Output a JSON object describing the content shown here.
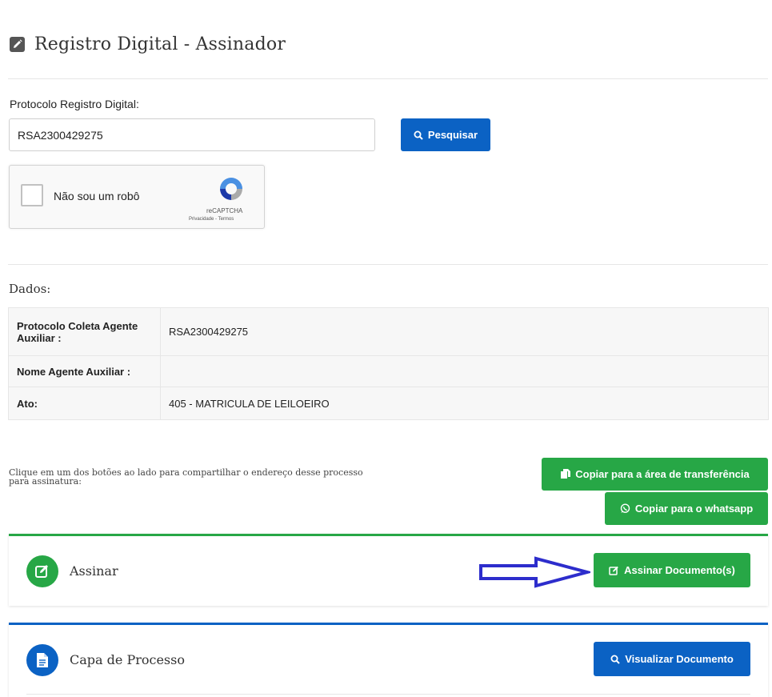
{
  "page": {
    "title": "Registro Digital - Assinador",
    "title_icon": "pencil-square-icon"
  },
  "search": {
    "label": "Protocolo Registro Digital:",
    "value": "RSA2300429275",
    "button_label": "Pesquisar",
    "button_icon": "search-icon"
  },
  "captcha": {
    "label": "Não sou um robô",
    "brand": "reCAPTCHA",
    "terms": "Privacidade - Termos"
  },
  "dados": {
    "title": "Dados:",
    "rows": [
      {
        "key": "Protocolo Coleta Agente Auxiliar :",
        "value": "RSA2300429275"
      },
      {
        "key": "Nome Agente Auxiliar :",
        "value": ""
      },
      {
        "key": "Ato:",
        "value": "405 - MATRICULA DE LEILOEIRO"
      }
    ]
  },
  "share": {
    "text": "Clique em um dos botões ao lado para compartilhar o endereço desse processo para assinatura:",
    "copy_label": "Copiar para a área de transferência",
    "whatsapp_label": "Copiar para o whatsapp"
  },
  "assinar": {
    "title": "Assinar",
    "button_label": "Assinar Documento(s)"
  },
  "capa": {
    "title": "Capa de Processo",
    "button_label": "Visualizar Documento"
  },
  "colors": {
    "primary_blue": "#0b62c4",
    "success_green": "#27a746",
    "annotation_arrow": "#2d2dcc"
  }
}
